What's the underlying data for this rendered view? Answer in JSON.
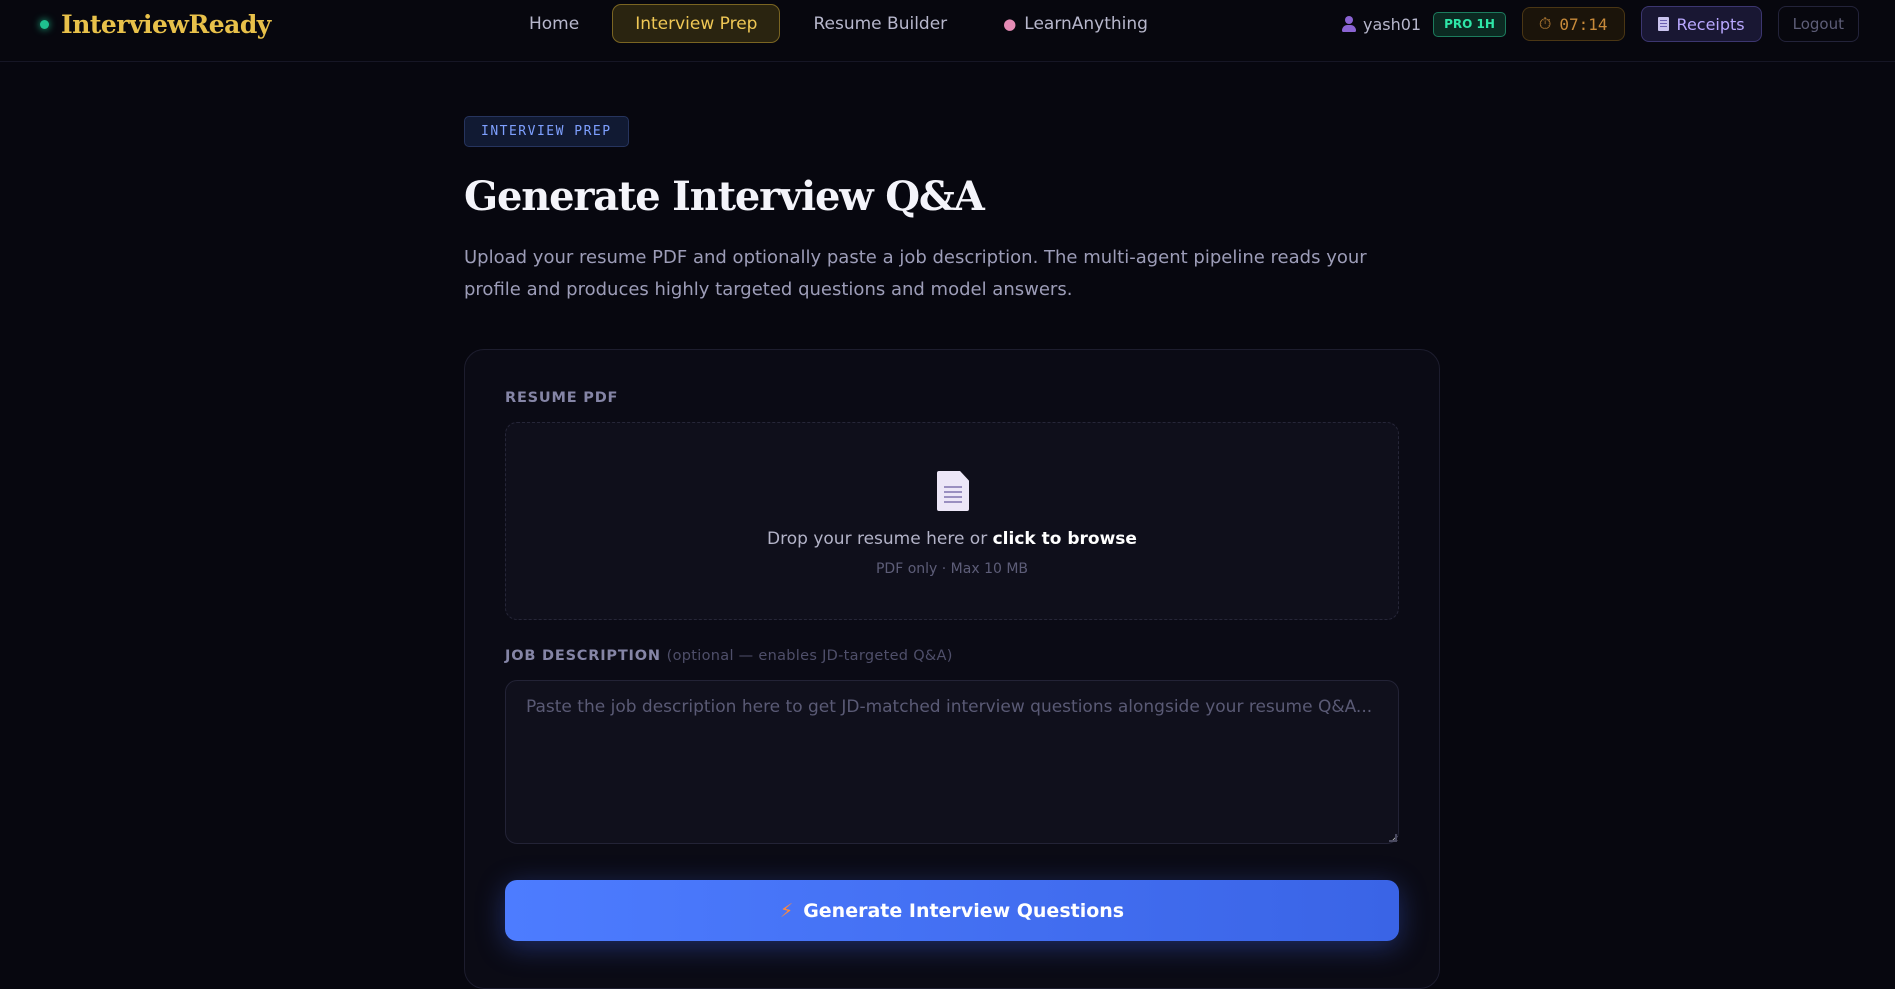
{
  "brand": {
    "name": "InterviewReady"
  },
  "nav": {
    "home": "Home",
    "interview_prep": "Interview Prep",
    "resume_builder": "Resume Builder",
    "learn_anything": "LearnAnything"
  },
  "user": {
    "name": "yash01",
    "plan_badge": "PRO 1H",
    "timer": "07:14",
    "receipts": "Receipts",
    "logout": "Logout"
  },
  "page": {
    "eyebrow": "INTERVIEW PREP",
    "title": "Generate Interview Q&A",
    "description": "Upload your resume PDF and optionally paste a job description. The multi-agent pipeline reads your profile and produces highly targeted questions and model answers."
  },
  "form": {
    "resume_label": "RESUME PDF",
    "drop_text_prefix": "Drop your resume here or ",
    "drop_text_action": "click to browse",
    "drop_sub": "PDF only · Max 10 MB",
    "jd_label": "JOB DESCRIPTION",
    "jd_optional": "(optional — enables JD-targeted Q&A)",
    "jd_placeholder": "Paste the job description here to get JD-matched interview questions alongside your resume Q&A...",
    "jd_value": "",
    "generate_label": "Generate Interview Questions"
  },
  "colors": {
    "brand": "#e8c14a",
    "accent": "#4d7cff",
    "badge": "#2ee6a8",
    "timer": "#c88a3a"
  },
  "icons": {
    "brand_dot": "status-dot",
    "nav_learn": "brain-icon",
    "user": "user-icon",
    "timer": "stopwatch-icon",
    "receipts": "receipt-icon",
    "drop": "document-icon",
    "generate": "lightning-icon"
  }
}
